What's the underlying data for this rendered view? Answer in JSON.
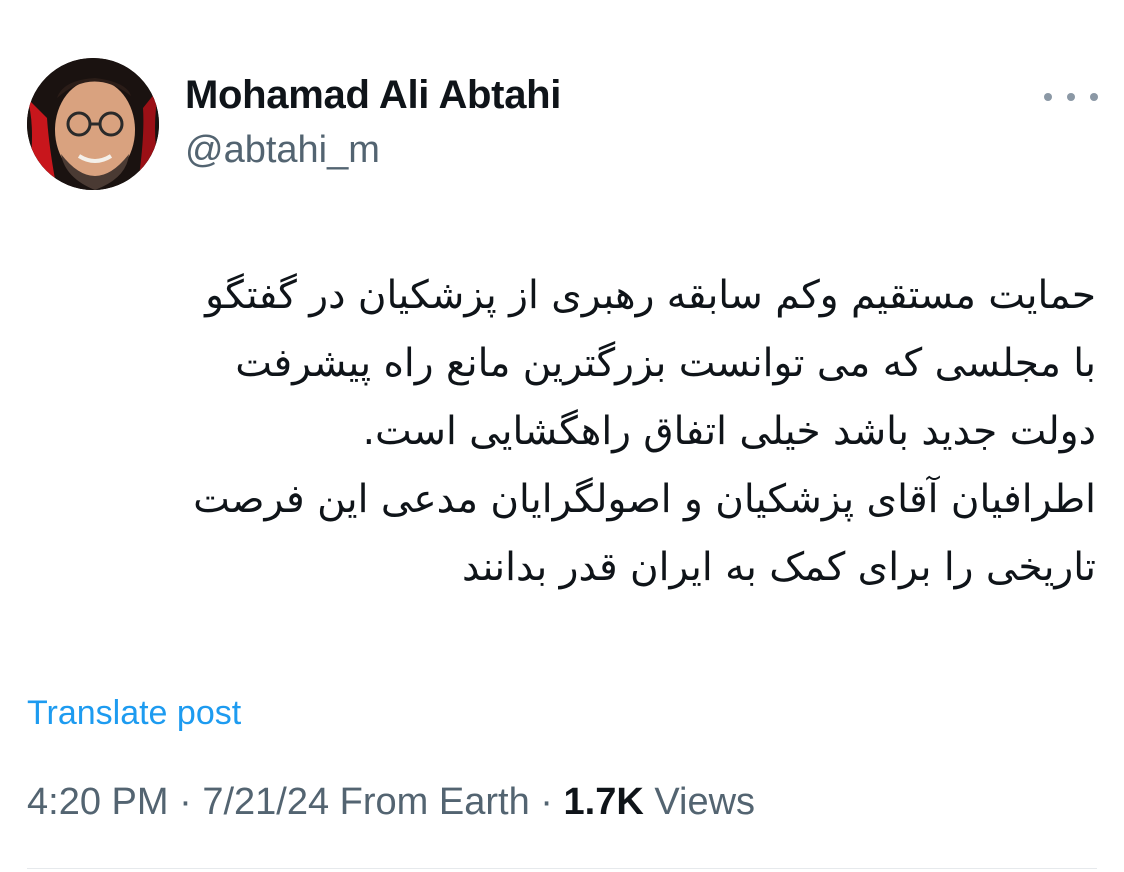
{
  "author": {
    "name": "Mohamad Ali Abtahi",
    "handle": "@abtahi_m",
    "avatar_icon": "profile-photo"
  },
  "more_menu": {
    "icon": "more-horizontal-icon"
  },
  "tweet": {
    "lines": [
      "حمایت مستقیم وکم سابقه رهبری از پزشکیان در گفتگو",
      "با مجلسی که می توانست بزرگترین مانع راه پیشرفت",
      "دولت جدید باشد خیلی اتفاق راهگشایی است.",
      "اطرافیان آقای پزشکیان و اصولگرایان مدعی این فرصت",
      "تاریخی را برای کمک به ایران قدر بدانند"
    ]
  },
  "translate": {
    "label": "Translate post"
  },
  "meta": {
    "time": "4:20 PM",
    "separator": " · ",
    "date": "7/21/24",
    "source": "From Earth",
    "views_count": "1.7K",
    "views_label": "Views"
  },
  "colors": {
    "text": "#0f1419",
    "secondary": "#536471",
    "link": "#1d9bf0"
  }
}
